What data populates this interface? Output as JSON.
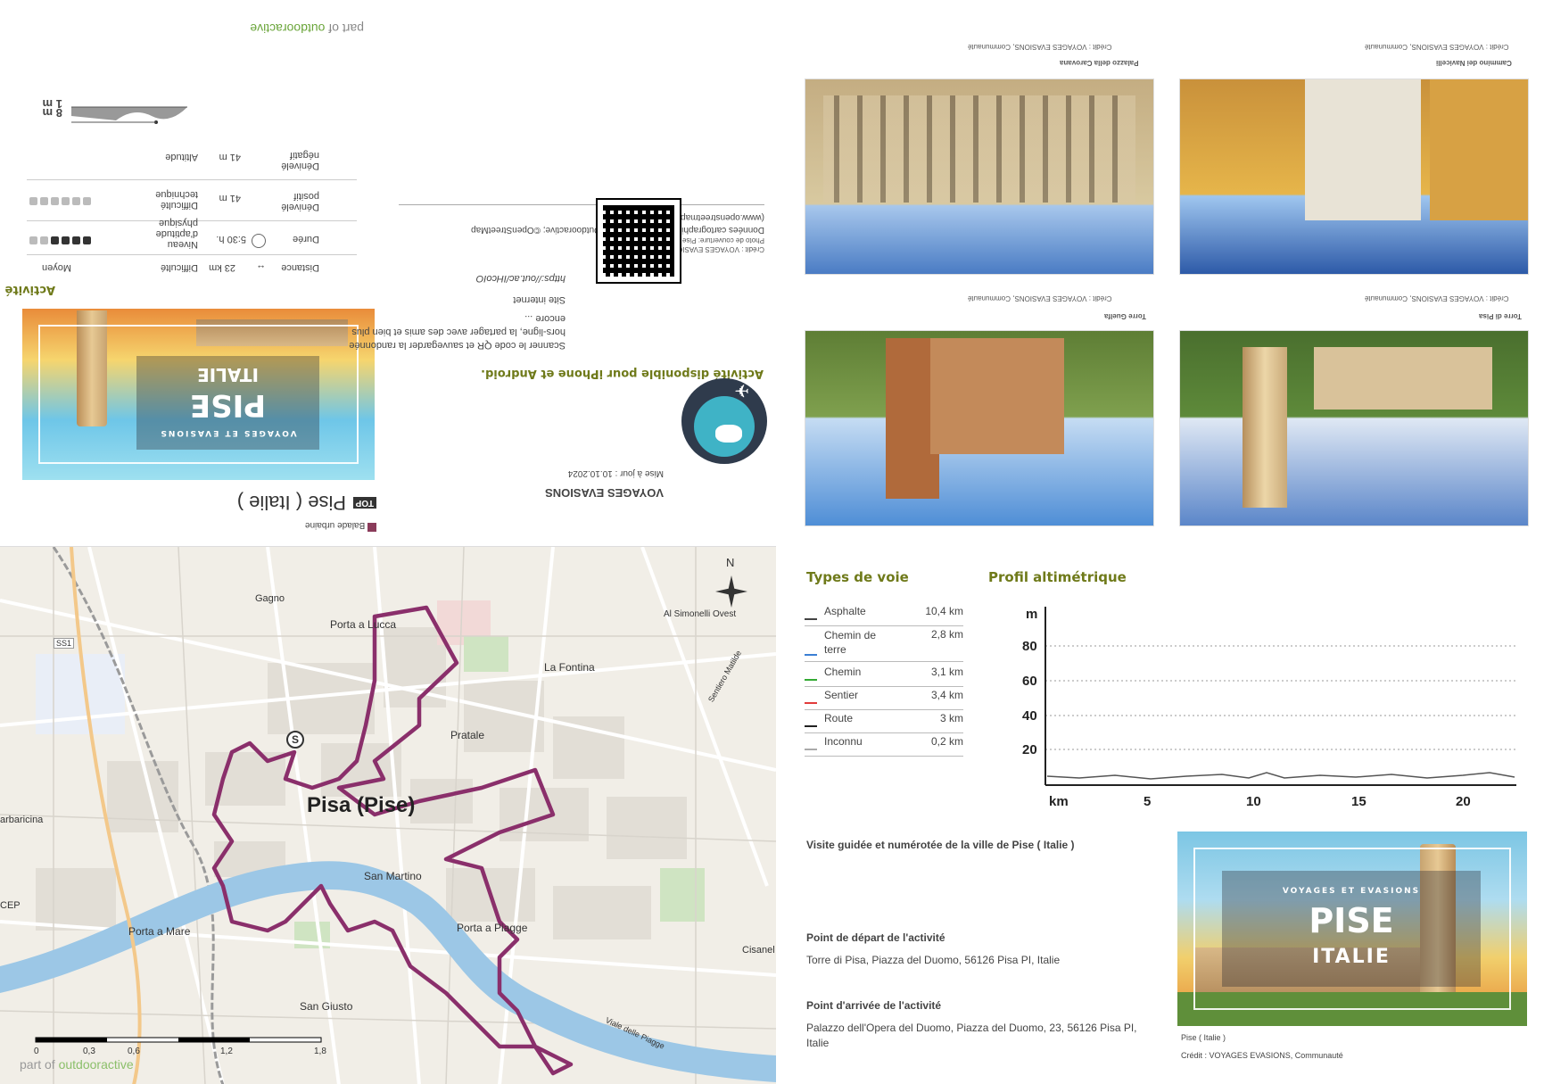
{
  "upper_left": {
    "brand_part": "part of",
    "brand_name": "outdooractive",
    "altitude_max": "8 m",
    "altitude_min": "1 m",
    "stats": {
      "altitude_label": "Altitude",
      "neg_value": "41 m",
      "neg_label": "Dénivelé négatif",
      "tech_label": "Difficulté technique",
      "pos_value": "41 m",
      "pos_label": "Dénivelé positif",
      "fitness_label": "Niveau d'aptitude physique",
      "duration_value": "5:30 h.",
      "duration_label": "Durée",
      "difficulty_value": "Moyen",
      "difficulty_label": "Difficulté",
      "distance_value": "23 km",
      "distance_label": "Distance",
      "activity_title": "Activité"
    },
    "cover": {
      "subtitle": "VOYAGES ET EVASIONS",
      "title": "PISE",
      "country": "ITALIE"
    },
    "top_badge": "TOP",
    "activity_name": "Pise ( Italie )",
    "category": "Balade urbaine",
    "osm_text": "Données cartographique: Cartographie d'Outdooractive; ©OpenStreetMap (www.openstreetmap.org)",
    "cover_credit_photo": "Photo de couverture: Pise ( Italie )",
    "cover_credit": "Crédit : VOYAGES EVASIONS, Communauté",
    "url": "https://out.ac/IHcoIO",
    "site_label": "Site internet",
    "qr_text": "Scanner le code QR et sauvegarder la randonnée hors-ligne, la partager avec des amis et bien plus encore ...",
    "app_text": "Activité disponible pour iPhone et Android.",
    "author": "VOYAGES EVASIONS",
    "updated": "Mise à jour : 10.10.2024"
  },
  "map": {
    "labels": {
      "gagno": "Gagno",
      "porta_lucca": "Porta a Lucca",
      "la_fontina": "La Fontina",
      "al_simonelli": "Al Simonelli Ovest",
      "pratale": "Pratale",
      "pisa": "Pisa (Pise)",
      "barbaricina": "arbaricina",
      "san_martino": "San Martino",
      "cep": "CEP",
      "porta_mare": "Porta a Mare",
      "porta_piagge": "Porta a Piagge",
      "cisanello": "Cisanel",
      "san_giusto": "San Giusto",
      "ss1": "SS1",
      "sentiero": "Sentiero Matilde",
      "viale": "Viale delle Piagge",
      "start": "S"
    },
    "north": "N",
    "scale": [
      "0",
      "0,3",
      "0,6",
      "1,2",
      "1,8"
    ],
    "watermark_part": "part of",
    "watermark_brand": "outdooractive"
  },
  "photos": [
    {
      "caption": "Palazzo della Carovana",
      "credit": "Crédit : VOYAGES EVASIONS, Communauté"
    },
    {
      "caption": "Cammino dei Navicelli",
      "credit": "Crédit : VOYAGES EVASIONS, Communauté"
    },
    {
      "caption": "Torre Guelfa",
      "credit": "Crédit : VOYAGES EVASIONS, Communauté"
    },
    {
      "caption": "Torre di Pisa",
      "credit": "Crédit : VOYAGES EVASIONS, Communauté"
    }
  ],
  "ways": {
    "title": "Types de voie",
    "rows": [
      {
        "label": "Asphalte",
        "value": "10,4 km",
        "color": "#444444"
      },
      {
        "label": "Chemin de terre",
        "value": "2,8 km",
        "color": "#3b7fd4"
      },
      {
        "label": "Chemin",
        "value": "3,1 km",
        "color": "#33aa33"
      },
      {
        "label": "Sentier",
        "value": "3,4 km",
        "color": "#e23b3b"
      },
      {
        "label": "Route",
        "value": "3 km",
        "color": "#222222"
      },
      {
        "label": "Inconnu",
        "value": "0,2 km",
        "color": "#aaaaaa"
      }
    ]
  },
  "profile": {
    "title": "Profil altimétrique",
    "y_unit": "m",
    "y_ticks": [
      "80",
      "60",
      "40",
      "20"
    ],
    "x_unit": "km",
    "x_ticks": [
      "5",
      "10",
      "15",
      "20"
    ]
  },
  "description": "Visite guidée et numérotée de la ville de Pise ( Italie )",
  "start": {
    "title": "Point de départ de l'activité",
    "text": "Torre di Pisa, Piazza del Duomo, 56126 Pisa PI, Italie"
  },
  "end": {
    "title": "Point d'arrivée de l'activité",
    "text": "Palazzo dell'Opera del Duomo, Piazza del Duomo, 23, 56126 Pisa PI, Italie"
  },
  "cover_right": {
    "subtitle": "VOYAGES ET EVASIONS",
    "title": "PISE",
    "country": "ITALIE",
    "caption": "Pise ( Italie )",
    "credit": "Crédit : VOYAGES EVASIONS, Communauté"
  }
}
